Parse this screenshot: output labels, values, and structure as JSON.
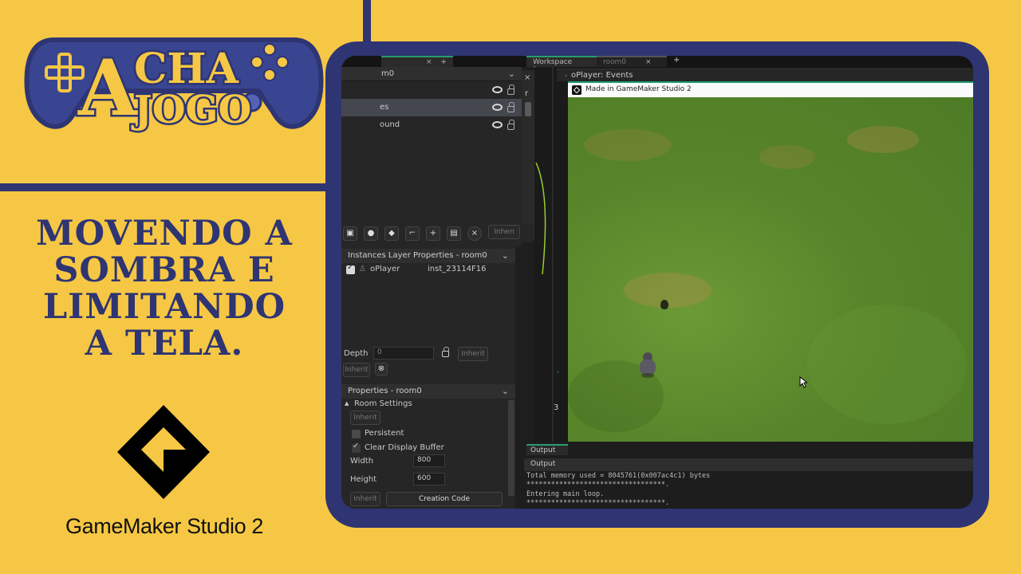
{
  "logo": {
    "words": [
      "A",
      "CHA",
      "JOGO"
    ],
    "colors": {
      "navy": "#2e3572",
      "yellow": "#f6c744"
    }
  },
  "headline": {
    "lines": [
      "MOVENDO A",
      "SOMBRA E",
      "LIMITANDO",
      "A TELA."
    ]
  },
  "brand": {
    "name": "GameMaker Studio 2",
    "icon": "gamemaker-logo-icon"
  },
  "ide": {
    "tabs": [
      {
        "label": "Workspace 1"
      },
      {
        "label": "room0"
      }
    ],
    "layers_header": {
      "room": "m0"
    },
    "layers": [
      {
        "label": "es"
      },
      {
        "label": "ound"
      }
    ],
    "layer_toolbar": {
      "inherit": "Inhen"
    },
    "instances_panel": {
      "title": "Instances Layer Properties - room0",
      "instances": [
        {
          "object": "oPlayer",
          "id": "inst_23114F16",
          "checked": true
        }
      ],
      "depth_label": "Depth",
      "depth_value": "0",
      "inherit_label": "Inherit",
      "inherit_label_2": "Inherit"
    },
    "properties_panel": {
      "title": "Properties - room0",
      "section": "Room Settings",
      "inherit_label": "Inherit",
      "persistent_label": "Persistent",
      "persistent": false,
      "clear_display_label": "Clear Display Buffer",
      "clear_display": true,
      "width_label": "Width",
      "width_value": "800",
      "height_label": "Height",
      "height_value": "600",
      "inherit_bottom": "Inherit",
      "creation_code": "Creation Code"
    },
    "events_title": "oPlayer: Events",
    "game_window_title": "Made in GameMaker Studio 2",
    "side_marker": "3",
    "output_tab": "Output",
    "output_bar": "Output",
    "output_lines": [
      "Total memory used = 8045761(0x007ac4c1) bytes",
      "**********************************.",
      "Entering main loop.",
      "**********************************."
    ]
  }
}
